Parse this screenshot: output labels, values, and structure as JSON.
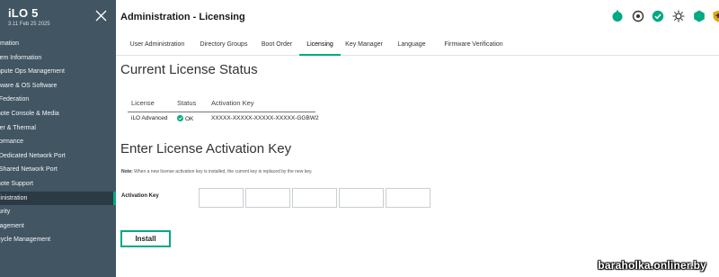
{
  "sidebar": {
    "brand_title": "iLO 5",
    "brand_subtitle": "3.11 Feb 25 2025",
    "items": [
      {
        "label": "Information"
      },
      {
        "label": "System Information"
      },
      {
        "label": "Compute Ops Management"
      },
      {
        "label": "Firmware & OS Software"
      },
      {
        "label": "iLO Federation"
      },
      {
        "label": "Remote Console & Media"
      },
      {
        "label": "Power & Thermal"
      },
      {
        "label": "Performance"
      },
      {
        "label": "iLO Dedicated Network Port"
      },
      {
        "label": "iLO Shared Network Port"
      },
      {
        "label": "Remote Support"
      },
      {
        "label": "Administration",
        "active": true
      },
      {
        "label": "Security"
      },
      {
        "label": "Management"
      },
      {
        "label": "Lifecycle Management"
      }
    ]
  },
  "header": {
    "title": "Administration - Licensing",
    "status_icons": [
      "health-icon",
      "power-icon",
      "ok-check-icon",
      "uid-light-icon",
      "hexagon-status-icon",
      "security-shield-icon"
    ],
    "tabs": [
      {
        "label": "User Administration"
      },
      {
        "label": "Directory Groups"
      },
      {
        "label": "Boot Order"
      },
      {
        "label": "Licensing",
        "active": true
      },
      {
        "label": "Key Manager"
      },
      {
        "label": "Language"
      },
      {
        "label": "Firmware Verification"
      }
    ]
  },
  "main": {
    "status_heading": "Current License Status",
    "table": {
      "headers": [
        "License",
        "Status",
        "Activation Key"
      ],
      "row": {
        "license": "iLO Advanced",
        "status": "OK",
        "key": "XXXXX-XXXXX-XXXXX-XXXXX-GGBW2"
      }
    },
    "activation_heading": "Enter License Activation Key",
    "note_label": "Note:",
    "note_text": "When a new license activation key is installed, the current key is replaced by the new key.",
    "activation_key_label": "Activation Key",
    "activation_key_fields": [
      "",
      "",
      "",
      "",
      ""
    ],
    "install_label": "Install"
  },
  "watermark": "baraholka.onliner.by",
  "colors": {
    "sidebar": "#425563",
    "accent": "#01a982",
    "ok": "#01a982",
    "warning": "#e5a11a"
  }
}
